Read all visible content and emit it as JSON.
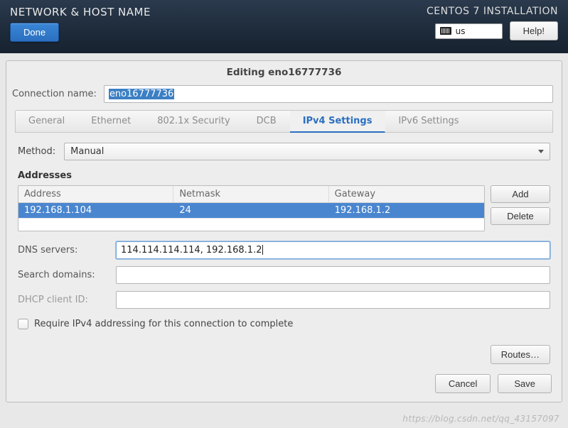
{
  "header": {
    "title": "NETWORK & HOST NAME",
    "done": "Done",
    "install_title": "CENTOS 7 INSTALLATION",
    "keyboard": "us",
    "help": "Help!"
  },
  "dialog": {
    "title": "Editing eno16777736",
    "conn_label": "Connection name:",
    "conn_value": "eno16777736",
    "tabs": [
      "General",
      "Ethernet",
      "802.1x Security",
      "DCB",
      "IPv4 Settings",
      "IPv6 Settings"
    ],
    "active_tab": "IPv4 Settings",
    "method_label": "Method:",
    "method_value": "Manual",
    "addresses_label": "Addresses",
    "addr_headers": {
      "address": "Address",
      "netmask": "Netmask",
      "gateway": "Gateway"
    },
    "addr_row": {
      "address": "192.168.1.104",
      "netmask": "24",
      "gateway": "192.168.1.2"
    },
    "add": "Add",
    "delete": "Delete",
    "dns_label": "DNS servers:",
    "dns_value": "114.114.114.114, 192.168.1.2",
    "search_label": "Search domains:",
    "search_value": "",
    "dhcp_label": "DHCP client ID:",
    "dhcp_value": "",
    "require_label": "Require IPv4 addressing for this connection to complete",
    "routes": "Routes…",
    "cancel": "Cancel",
    "save": "Save"
  },
  "watermark": "https://blog.csdn.net/qq_43157097"
}
